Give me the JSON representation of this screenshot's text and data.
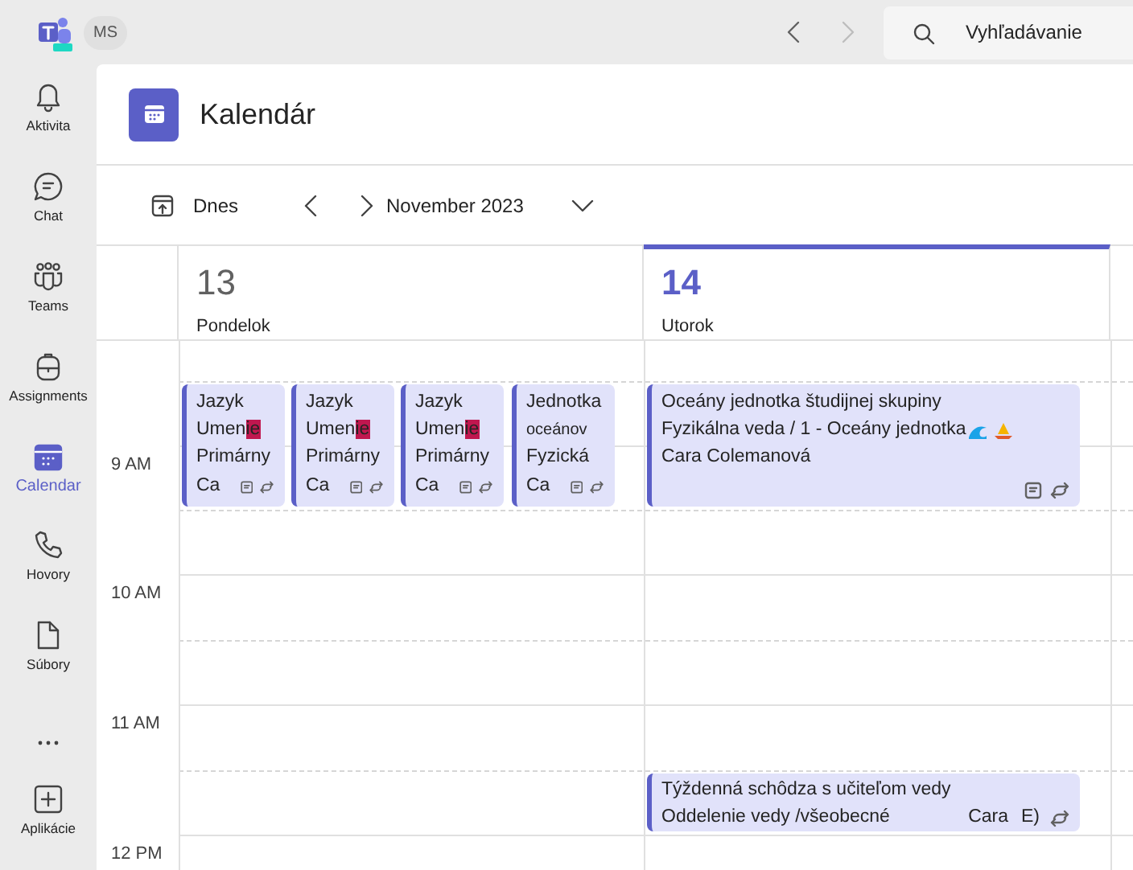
{
  "top_bar": {
    "account_badge": "MS",
    "search": {
      "placeholder": "Vyhľadávanie"
    }
  },
  "sidebar": {
    "items": [
      {
        "kind": "bell",
        "label": "Aktivita",
        "selected": false
      },
      {
        "kind": "chat",
        "label": "Chat",
        "selected": false
      },
      {
        "kind": "teams",
        "label": "Teams",
        "selected": false
      },
      {
        "kind": "bag",
        "label": "Assignments",
        "selected": false
      },
      {
        "kind": "calendar",
        "label": "Calendar",
        "selected": true
      },
      {
        "kind": "phone",
        "label": "Hovory",
        "selected": false
      },
      {
        "kind": "file",
        "label": "Súbory",
        "selected": false
      },
      {
        "kind": "more",
        "selected": false
      },
      {
        "kind": "apps",
        "label": "Aplikácie",
        "selected": false
      }
    ]
  },
  "header": {
    "title": "Kalendár"
  },
  "toolbar": {
    "today": "Dnes",
    "period": "November 2023"
  },
  "hours": [
    "9 AM",
    "10 AM",
    "11 AM",
    "12 PM"
  ],
  "days": [
    {
      "number": "13",
      "name": "Pondelok",
      "selected": false,
      "events": [
        {
          "kind": "block",
          "lines": [
            {
              "text": "Jazyk"
            },
            {
              "text": "Umen",
              "highlight": "ie"
            },
            {
              "text": "Primárny"
            }
          ],
          "organizer": "Ca",
          "notes": true,
          "recurring": true
        },
        {
          "kind": "block",
          "lines": [
            {
              "text": "Jazyk"
            },
            {
              "text": "Umen",
              "highlight": "ie"
            },
            {
              "text": "Primárny"
            }
          ],
          "organizer": "Ca",
          "notes": true,
          "recurring": true
        },
        {
          "kind": "block",
          "lines": [
            {
              "text": "Jazyk"
            },
            {
              "text": "Umen",
              "highlight": "ie"
            },
            {
              "text": "Primárny"
            }
          ],
          "organizer": "Ca",
          "notes": true,
          "recurring": true
        },
        {
          "kind": "block",
          "lines": [
            {
              "text": "Jednotka"
            },
            {
              "text": "oceánov"
            },
            {
              "text": "Fyzická"
            }
          ],
          "organizer": "Ca",
          "notes": true,
          "recurring": true
        }
      ]
    },
    {
      "number": "14",
      "name": "Utorok",
      "selected": true,
      "events": [
        {
          "kind": "block",
          "lines": [
            {
              "text": "Oceány jednotka študijnej skupiny"
            },
            {
              "text": "Fyzikálna veda / 1 - Oceány jednotka"
            },
            {
              "text": "Cara Colemanová"
            }
          ],
          "notes": true,
          "recurring": true
        },
        {
          "kind": "compact",
          "lines": [
            {
              "text": "Týždenná schôdza s učiteľom vedy"
            },
            {
              "text": "Oddelenie vedy /všeobecné"
            }
          ],
          "organizer": "Cara",
          "extra": "E)",
          "notes": false,
          "recurring": true
        }
      ]
    }
  ]
}
